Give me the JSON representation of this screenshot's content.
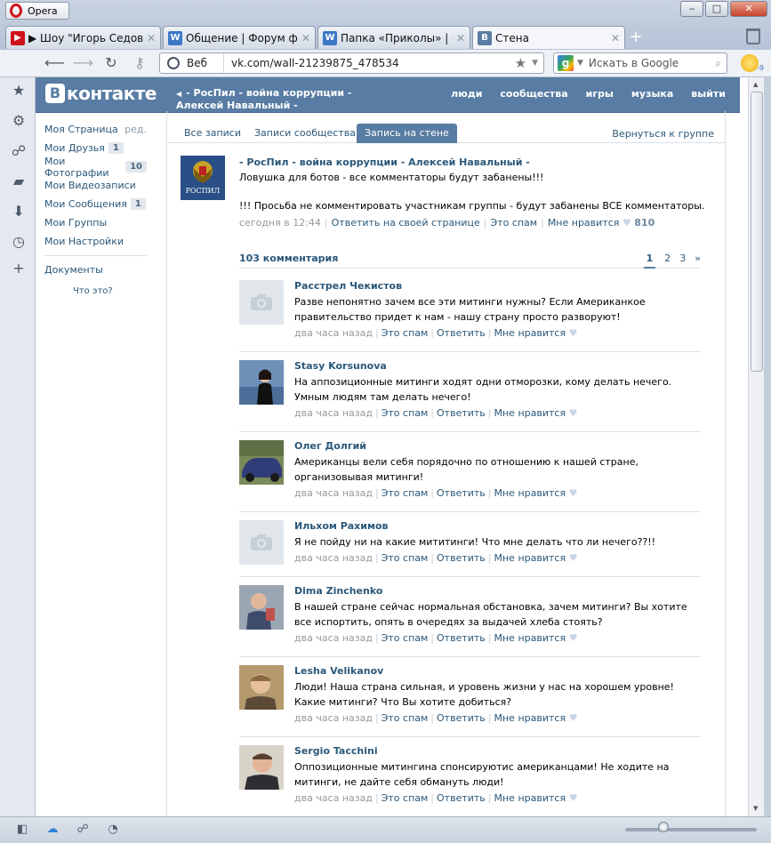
{
  "browser": {
    "menu_label": "Opera",
    "window_buttons": {
      "minimize": "‒",
      "maximize": "□",
      "close": "✕"
    },
    "tabs": [
      {
        "title": "▶ Шоу \"Игорь Седов\" ...",
        "favicon": "youtube-icon",
        "active": false
      },
      {
        "title": "Общение | Форум фр...",
        "favicon": "w-icon",
        "active": false
      },
      {
        "title": "Папка «Приколы» | О...",
        "favicon": "w-icon",
        "active": false
      },
      {
        "title": "Стена",
        "favicon": "vk-icon",
        "active": true
      }
    ],
    "new_tab": "+",
    "address": {
      "mode_label": "Веб",
      "url": "vk.com/wall-21239875_478534"
    },
    "search": {
      "placeholder": "Искать в Google"
    },
    "weather_badge": "-9"
  },
  "vk": {
    "logo_letter": "В",
    "logo_word": "контакте",
    "group_title": "- РосПил - война коррупции - Алексей Навальный -",
    "nav": [
      "люди",
      "сообщества",
      "игры",
      "музыка",
      "выйти"
    ],
    "left_menu": [
      {
        "label": "Моя Страница",
        "extra": "ред.",
        "count": ""
      },
      {
        "label": "Мои Друзья",
        "extra": "",
        "count": "1"
      },
      {
        "label": "Мои Фотографии",
        "extra": "",
        "count": "10"
      },
      {
        "label": "Мои Видеозаписи",
        "extra": "",
        "count": ""
      },
      {
        "label": "Мои Сообщения",
        "extra": "",
        "count": "1"
      },
      {
        "label": "Мои Группы",
        "extra": "",
        "count": ""
      },
      {
        "label": "Мои Настройки",
        "extra": "",
        "count": ""
      }
    ],
    "documents": "Документы",
    "what_is_this": "Что это?",
    "wall_tabs": [
      "Все записи",
      "Записи сообщества",
      "Запись на стене"
    ],
    "back_to_group": "Вернуться к группе",
    "post": {
      "avatar_caption": "РОСПИЛ",
      "author": "- РосПил - война коррупции - Алексей Навальный -",
      "line1": "Ловушка для ботов - все комментаторы будут забанены!!!",
      "line2": "!!! Просьба не комментировать участникам группы - будут забанены ВСЕ комментаторы.",
      "time": "сегодня в 12:44",
      "reply_own": "Ответить на своей странице",
      "spam": "Это спам",
      "like": "Мне нравится",
      "likes": "810"
    },
    "comments_count": "103 комментария",
    "pages": [
      "1",
      "2",
      "3",
      "»"
    ],
    "comment_actions": {
      "time": "два часа назад",
      "spam": "Это спам",
      "reply": "Ответить",
      "like": "Мне нравится"
    },
    "comments": [
      {
        "name": "Расстрел Чекистов",
        "text": "Разве непонятно зачем все эти митинги нужны? Если Американкое правительство придет к нам - нашу страну просто разворуют!",
        "avatar": "no-photo"
      },
      {
        "name": "Stasy Korsunova",
        "text": "На аппозиционные митинги ходят одни отморозки, кому делать нечего. Умным людям там делать нечего!",
        "avatar": "girl"
      },
      {
        "name": "Олег Долгий",
        "text": "Американцы вели себя порядочно по отношению к нашей стране, организовывая митинги!",
        "avatar": "car"
      },
      {
        "name": "Ильхом Рахимов",
        "text": "Я не пойду ни на какие мититинги! Что мне делать что ли нечего??!!",
        "avatar": "no-photo"
      },
      {
        "name": "Dima Zinchenko",
        "text": "В нашей стране сейчас нормальная обстановка, зачем митинги? Вы хотите все испортить, опять в очередях за выдачей хлеба стоять?",
        "avatar": "man1"
      },
      {
        "name": "Lesha Velikanov",
        "text": "Люди! Наша страна сильная, и уровень жизни у нас на хорошем уровне! Какие митинги? Что Вы хотите добиться?",
        "avatar": "man2"
      },
      {
        "name": "Sergio Tacchini",
        "text": "Оппозиционные митингина спонсируютис американцами! Не ходите на митинги, не дайте себя обмануть люди!",
        "avatar": "man3"
      }
    ]
  }
}
